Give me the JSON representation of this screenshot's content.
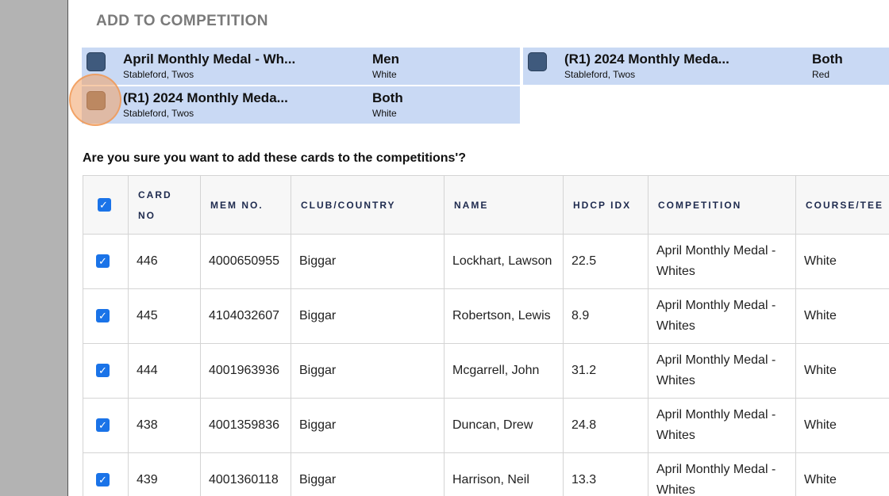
{
  "dialog": {
    "title": "ADD TO COMPETITION",
    "confirm_text": "Are you sure you want to add these cards to the competitions'?"
  },
  "competitions": [
    {
      "name": "April Monthly Medal - Wh...",
      "format": "Stableford, Twos",
      "gender": "Men",
      "tee": "White"
    },
    {
      "name": "(R1) 2024 Monthly Meda...",
      "format": "Stableford, Twos",
      "gender": "Both",
      "tee": "Red"
    },
    {
      "name": "(R1) 2024 Monthly Meda...",
      "format": "Stableford, Twos",
      "gender": "Both",
      "tee": "White"
    }
  ],
  "table": {
    "headers": [
      "CARD NO",
      "MEM NO.",
      "CLUB/COUNTRY",
      "NAME",
      "HDCP IDX",
      "COMPETITION",
      "COURSE/TEE"
    ],
    "check_glyph": "✓",
    "rows": [
      {
        "card": "446",
        "mem": "4000650955",
        "club": "Biggar",
        "name": "Lockhart, Lawson",
        "hdcp": "22.5",
        "comp": "April Monthly Medal - Whites",
        "tee": "White"
      },
      {
        "card": "445",
        "mem": "4104032607",
        "club": "Biggar",
        "name": "Robertson, Lewis",
        "hdcp": "8.9",
        "comp": "April Monthly Medal - Whites",
        "tee": "White"
      },
      {
        "card": "444",
        "mem": "4001963936",
        "club": "Biggar",
        "name": "Mcgarrell, John",
        "hdcp": "31.2",
        "comp": "April Monthly Medal - Whites",
        "tee": "White"
      },
      {
        "card": "438",
        "mem": "4001359836",
        "club": "Biggar",
        "name": "Duncan, Drew",
        "hdcp": "24.8",
        "comp": "April Monthly Medal - Whites",
        "tee": "White"
      },
      {
        "card": "439",
        "mem": "4001360118",
        "club": "Biggar",
        "name": "Harrison, Neil",
        "hdcp": "13.3",
        "comp": "April Monthly Medal - Whites",
        "tee": "White"
      }
    ]
  }
}
